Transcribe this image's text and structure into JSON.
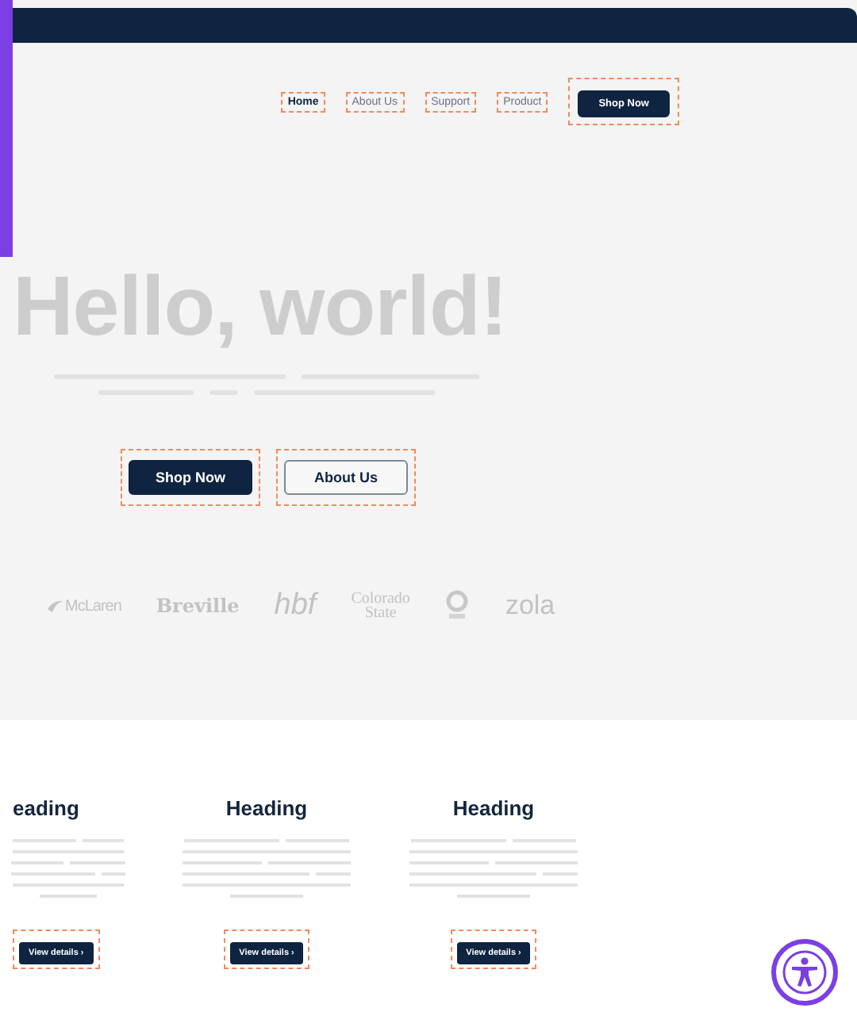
{
  "nav": {
    "links": [
      {
        "label": "Home",
        "selected": true
      },
      {
        "label": "About Us",
        "selected": false
      },
      {
        "label": "Support",
        "selected": false
      },
      {
        "label": "Product",
        "selected": false
      }
    ],
    "cta": "Shop Now"
  },
  "hero": {
    "title": "Hello, world!",
    "buttons": [
      {
        "label": "Shop Now",
        "kind": "primary"
      },
      {
        "label": "About Us",
        "kind": "secondary"
      }
    ]
  },
  "logos": [
    {
      "kind": "mclaren",
      "lines": [
        "McLaren"
      ]
    },
    {
      "kind": "breville",
      "lines": [
        "Breville"
      ]
    },
    {
      "kind": "hbf",
      "lines": [
        "hbf"
      ]
    },
    {
      "kind": "colorado",
      "lines": [
        "Colorado",
        "State"
      ]
    },
    {
      "kind": "engie"
    },
    {
      "kind": "zola",
      "lines": [
        "zola"
      ]
    }
  ],
  "cards": [
    {
      "heading": "eading",
      "button": "View details ›",
      "cut": true
    },
    {
      "heading": "Heading",
      "button": "View details ›",
      "cut": false
    },
    {
      "heading": "Heading",
      "button": "View details ›",
      "cut": false
    }
  ]
}
